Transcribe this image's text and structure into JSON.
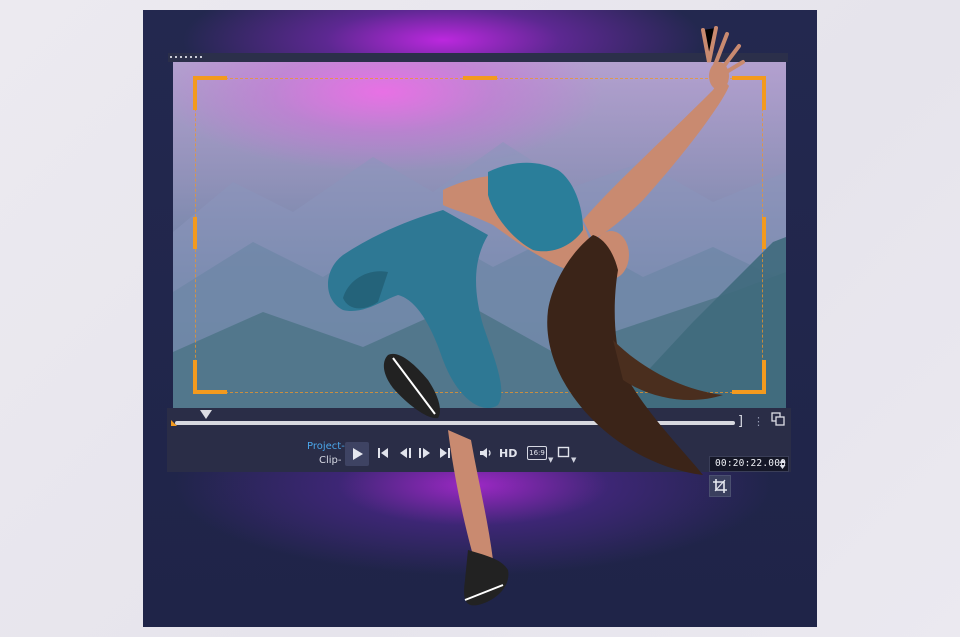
{
  "player": {
    "mode_project": "Project-",
    "mode_clip": "Clip-",
    "hd": "HD",
    "aspect": "16:9",
    "timecode": "00:20:22.000",
    "trim_end_mark": "]"
  },
  "icons": {
    "play": "play-icon",
    "go_start": "skip-to-start-icon",
    "prev_frame": "previous-frame-icon",
    "next_frame": "next-frame-icon",
    "go_end": "skip-to-end-icon",
    "repeat": "repeat-icon",
    "volume": "volume-icon",
    "aspect": "aspect-ratio-icon",
    "crop": "crop-icon",
    "copy": "copy-icon",
    "split": "split-icon"
  },
  "colors": {
    "accent_orange": "#f39a1e",
    "mode_blue": "#4aa6ea",
    "panel": "#2a2d47",
    "background": "#1f2448"
  }
}
